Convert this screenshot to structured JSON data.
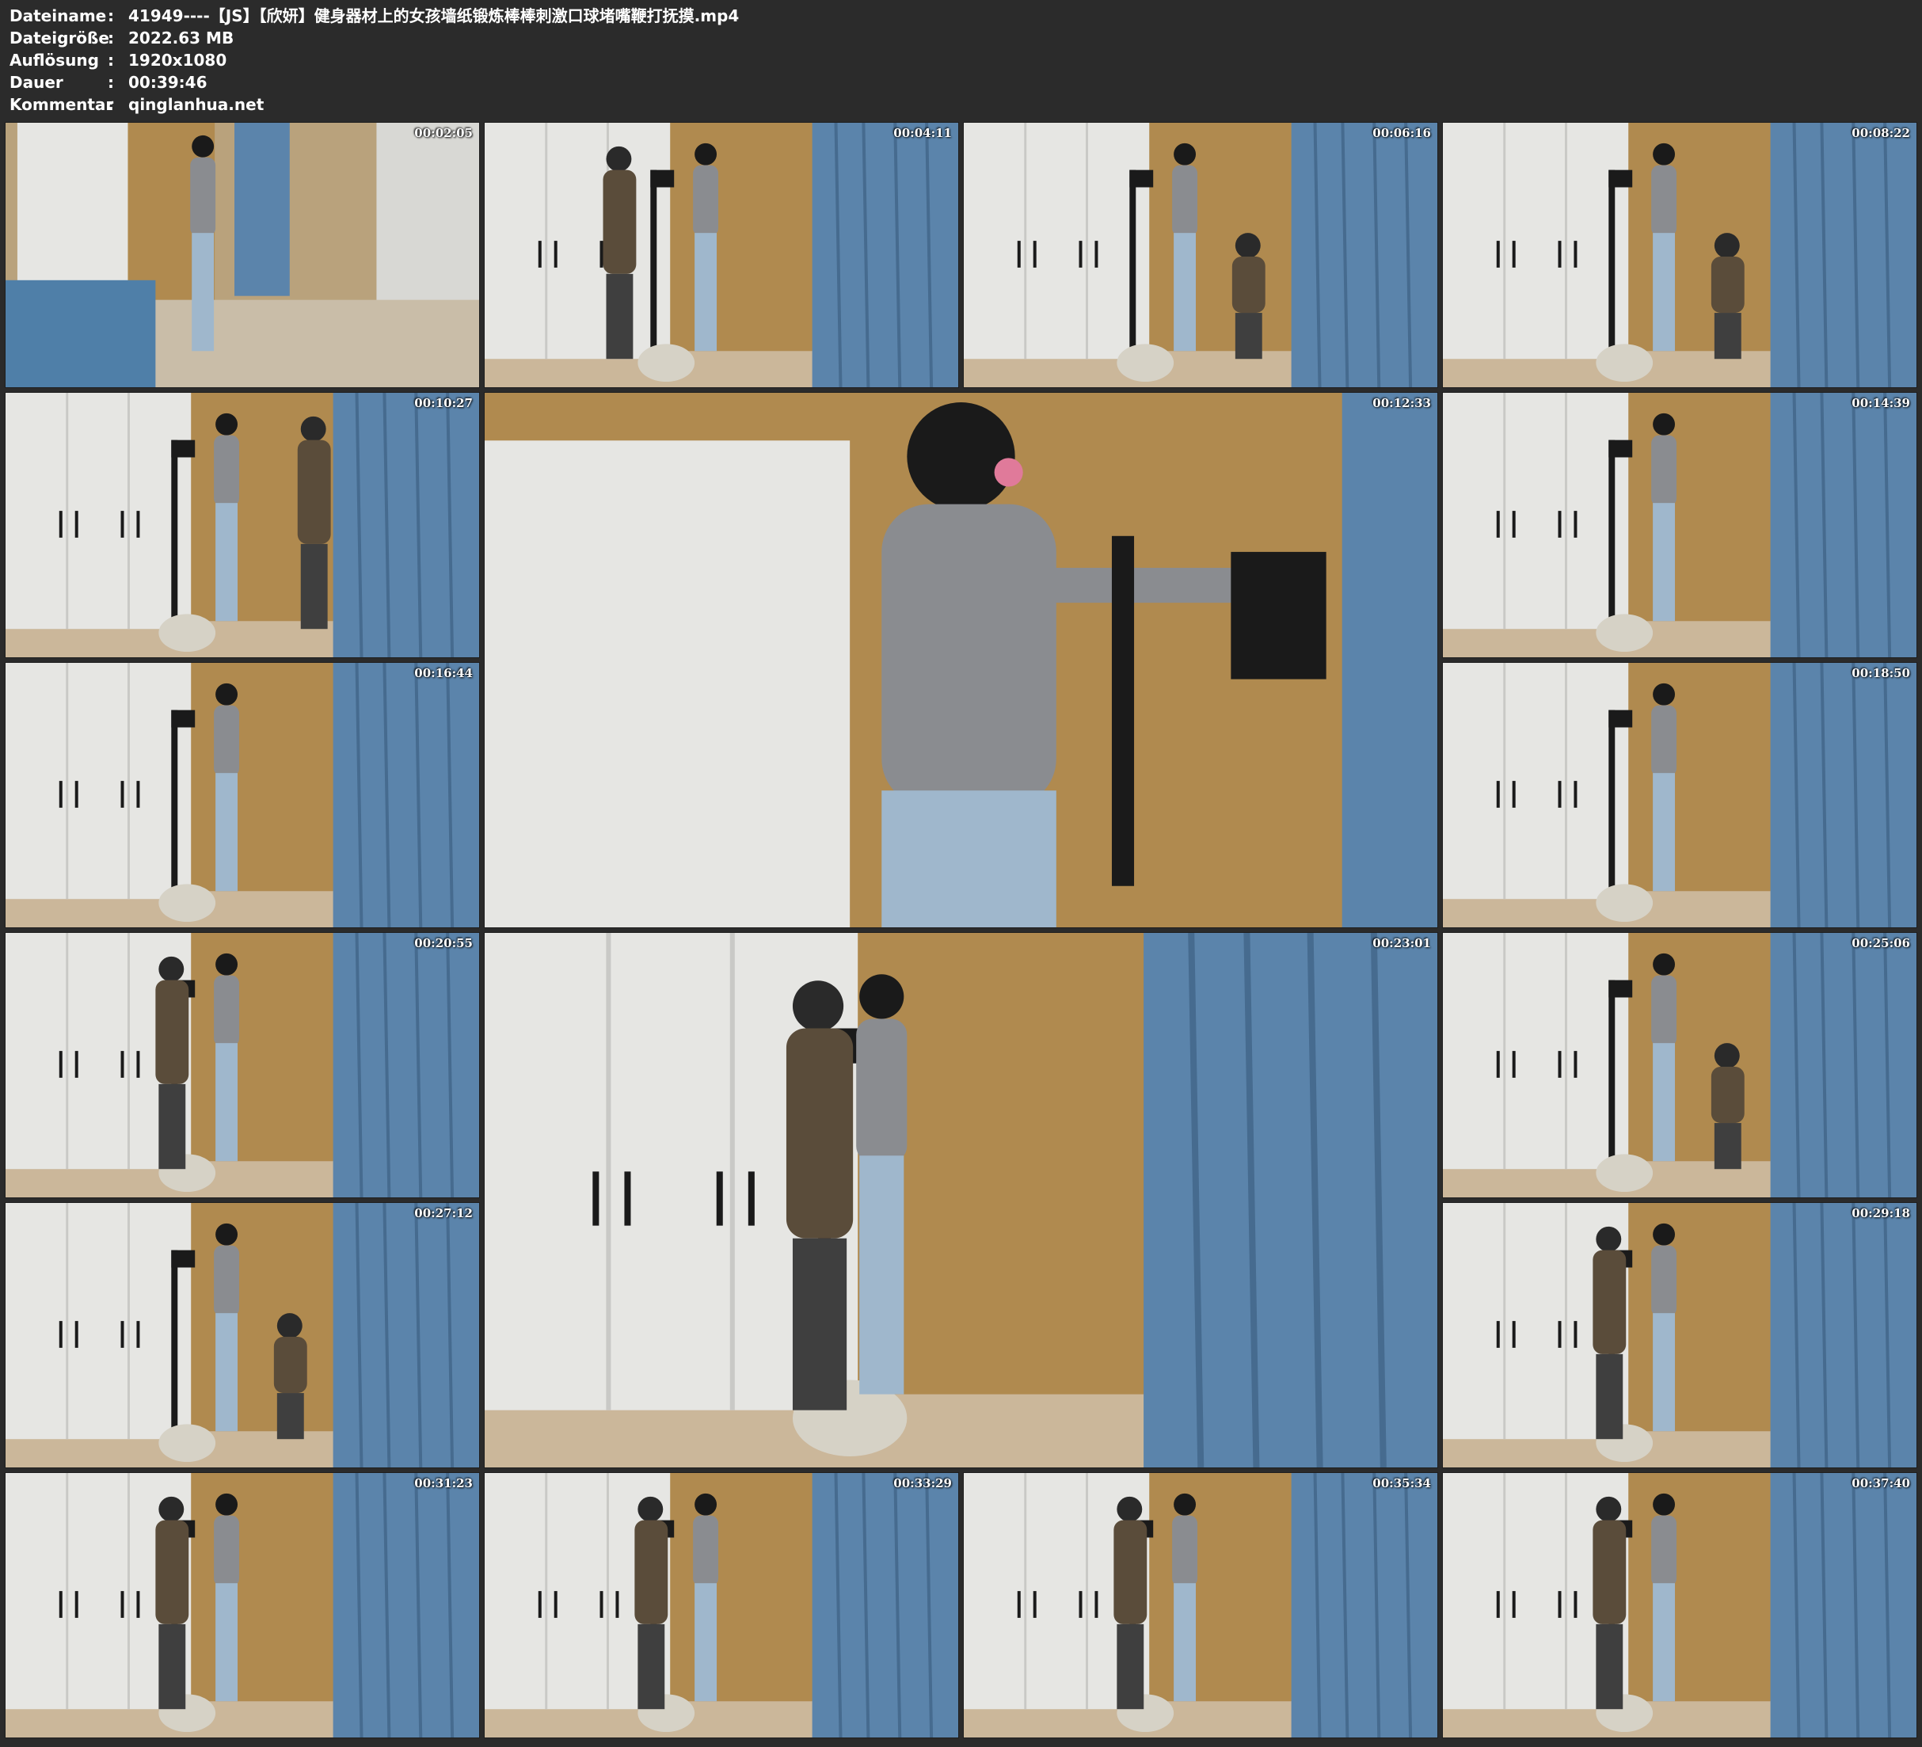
{
  "info": [
    {
      "key": "Dateiname",
      "value": "41949----【JS】【欣妍】健身器材上的女孩墙纸锻炼棒棒刺激口球堵嘴鞭打抚摸.mp4"
    },
    {
      "key": "Dateigröße",
      "value": "2022.63 MB"
    },
    {
      "key": "Auflösung",
      "value": "1920x1080"
    },
    {
      "key": "Dauer",
      "value": "00:39:46"
    },
    {
      "key": "Kommentar",
      "value": "qinglanhua.net"
    }
  ],
  "separator": ":",
  "thumbnails": [
    {
      "timestamp": "00:02:05",
      "scene": "wide-bedroom"
    },
    {
      "timestamp": "00:04:11",
      "scene": "man-left"
    },
    {
      "timestamp": "00:06:16",
      "scene": "man-kneel"
    },
    {
      "timestamp": "00:08:22",
      "scene": "man-kneel"
    },
    {
      "timestamp": "00:10:27",
      "scene": "man-right"
    },
    {
      "timestamp": "00:12:33",
      "scene": "closeup"
    },
    {
      "timestamp": "00:14:39",
      "scene": "solo"
    },
    {
      "timestamp": "00:16:44",
      "scene": "solo"
    },
    {
      "timestamp": "00:18:50",
      "scene": "solo"
    },
    {
      "timestamp": "00:20:55",
      "scene": "man-behind"
    },
    {
      "timestamp": "00:23:01",
      "scene": "large-duo"
    },
    {
      "timestamp": "00:25:06",
      "scene": "man-kneel"
    },
    {
      "timestamp": "00:27:12",
      "scene": "man-kneel"
    },
    {
      "timestamp": "00:29:18",
      "scene": "man-behind"
    },
    {
      "timestamp": "00:31:23",
      "scene": "man-behind"
    },
    {
      "timestamp": "00:33:29",
      "scene": "man-behind"
    },
    {
      "timestamp": "00:35:34",
      "scene": "man-behind"
    },
    {
      "timestamp": "00:37:40",
      "scene": "man-behind"
    }
  ],
  "colors": {
    "background": "#2b2b2b",
    "wardrobe": "#e6e6e3",
    "curtain_blue": "#5b84ab",
    "wall_gold": "#b08a4f",
    "floor": "#cbb79a",
    "sweater_grey": "#8a8c90",
    "jeans": "#9fb7cc",
    "hoodie": "#5a4c3a"
  }
}
